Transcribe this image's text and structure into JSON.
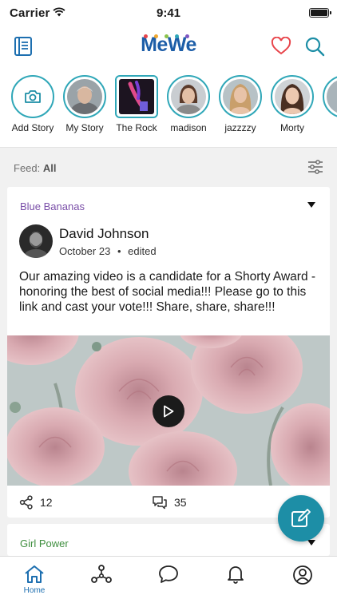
{
  "status_bar": {
    "carrier": "Carrier",
    "time": "9:41",
    "battery_level": 0.9
  },
  "header": {
    "logo_part1": "Me",
    "logo_part2": "We",
    "logo_dot_colors": [
      "#e8454b",
      "#f0a830",
      "#8bc34a",
      "#2fa7b8",
      "#7e57c2"
    ]
  },
  "stories": [
    {
      "name": "Add Story",
      "icon": "camera-icon"
    },
    {
      "name": "My Story"
    },
    {
      "name": "The Rock"
    },
    {
      "name": "madison"
    },
    {
      "name": "jazzzzy"
    },
    {
      "name": "Morty"
    }
  ],
  "feed": {
    "label": "Feed:",
    "value": "All"
  },
  "post": {
    "group": "Blue Bananas",
    "author": "David Johnson",
    "date": "October 23",
    "separator": "•",
    "edited": "edited",
    "text": "Our amazing video is a candidate for a Shorty Award - honoring the best of social media!!! Please go to this link and cast your vote!!! Share, share, share!!!",
    "shares": "12",
    "comments": "35"
  },
  "post2": {
    "group": "Girl Power"
  },
  "tabbar": {
    "home_label": "Home"
  },
  "colors": {
    "accent": "#1d8ea6",
    "brand_blue": "#1d5ea8",
    "story_ring": "#2fa7b8",
    "group_purple": "#7a4fa8",
    "group_green": "#3f8f3f",
    "heart": "#e8454b"
  }
}
